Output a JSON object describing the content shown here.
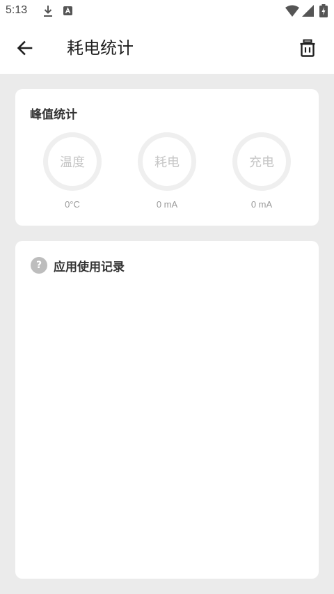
{
  "status_bar": {
    "time": "5:13",
    "icons": [
      "download-icon",
      "app-notification-icon",
      "wifi-icon",
      "signal-icon",
      "battery-charging-icon"
    ]
  },
  "app_bar": {
    "title": "耗电统计",
    "back_icon": "arrow-left-icon",
    "action_icon": "trash-icon"
  },
  "peak_card": {
    "title": "峰值统计",
    "gauges": [
      {
        "label": "温度",
        "value": "0°C"
      },
      {
        "label": "耗电",
        "value": "0 mA"
      },
      {
        "label": "充电",
        "value": "0 mA"
      }
    ]
  },
  "records_card": {
    "help_icon_glyph": "?",
    "title": "应用使用记录"
  },
  "colors": {
    "background": "#ebebeb",
    "card": "#ffffff",
    "gauge_ring": "#efefef",
    "muted_text": "#9a9a9a"
  }
}
